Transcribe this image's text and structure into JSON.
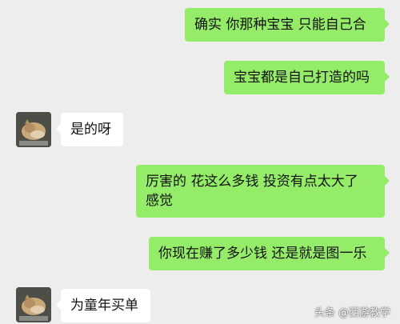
{
  "conversation": {
    "messages": [
      {
        "side": "sent",
        "text": "确实 你那种宝宝 只能自己合"
      },
      {
        "side": "sent",
        "text": "宝宝都是自己打造的吗"
      },
      {
        "side": "received",
        "text": "是的呀",
        "avatar_icon": "cat-avatar"
      },
      {
        "side": "sent",
        "text_line1": "厉害的  花这么多钱 投资有点太大了",
        "text_line2": "感觉"
      },
      {
        "side": "sent",
        "text": "你现在赚了多少钱 还是就是图一乐"
      },
      {
        "side": "received",
        "text": "为童年买单",
        "avatar_icon": "cat-avatar"
      }
    ]
  },
  "watermark": {
    "text": "头条 @西游教学"
  },
  "colors": {
    "background": "#ededed",
    "sent_bubble": "#95ec69",
    "received_bubble": "#ffffff"
  }
}
